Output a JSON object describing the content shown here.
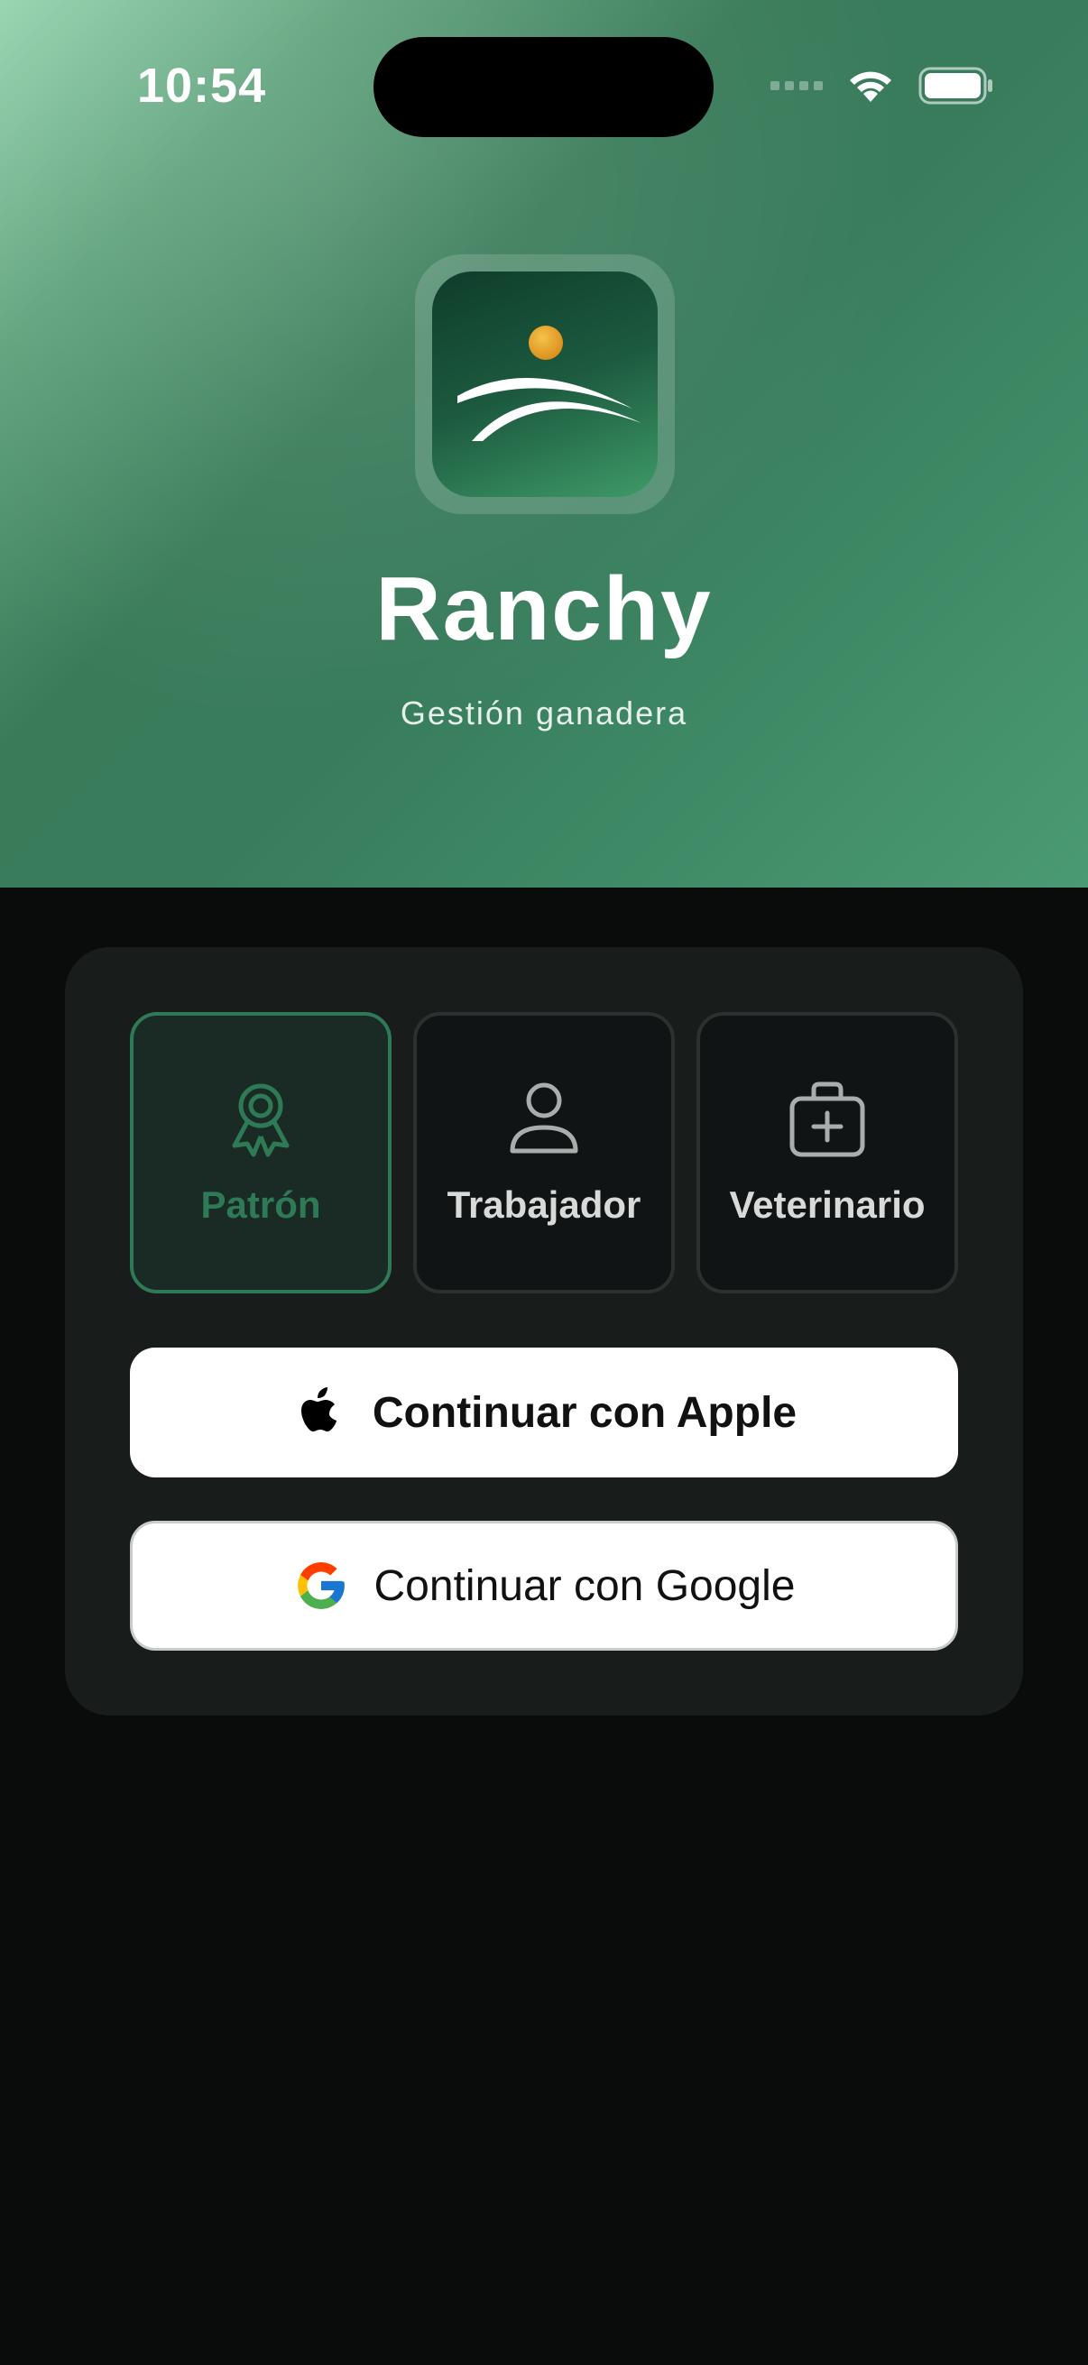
{
  "status_bar": {
    "time": "10:54"
  },
  "app": {
    "name": "Ranchy",
    "tagline": "Gestión ganadera"
  },
  "roles": [
    {
      "label": "Patrón",
      "icon": "award-icon",
      "selected": true
    },
    {
      "label": "Trabajador",
      "icon": "person-icon",
      "selected": false
    },
    {
      "label": "Veterinario",
      "icon": "medical-kit-icon",
      "selected": false
    }
  ],
  "auth": {
    "apple_label": "Continuar con Apple",
    "google_label": "Continuar con Google"
  },
  "colors": {
    "accent": "#2f7a56",
    "sun": "#e8a830",
    "background": "#0a0c0c",
    "card": "#181c1b"
  }
}
